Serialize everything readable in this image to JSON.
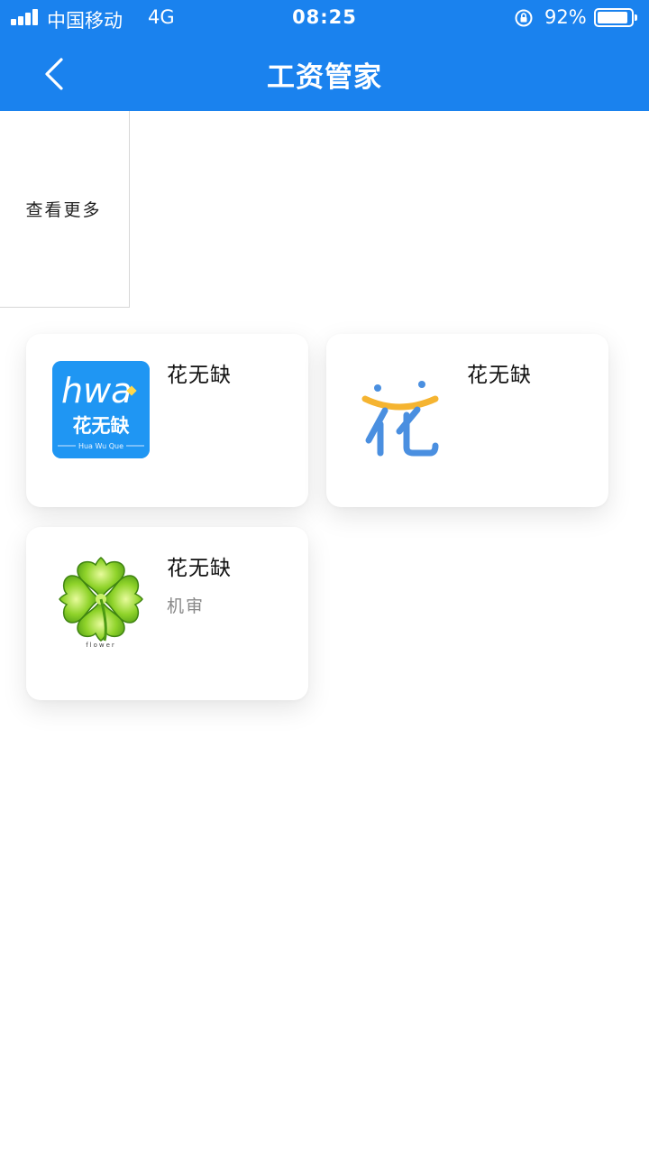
{
  "status_bar": {
    "carrier": "中国移动",
    "network": "4G",
    "time": "08:25",
    "battery": "92%",
    "battery_level": 0.92
  },
  "nav": {
    "title": "工资管家",
    "back_icon": "chevron-left-icon"
  },
  "more": {
    "label": "查看更多"
  },
  "cards": [
    {
      "name": "花无缺",
      "subtitle": "",
      "logo_icon": "hwq-logo-icon",
      "logo_text": "花无缺",
      "logo_word": "hwa",
      "logo_caption": "Hua Wu Que"
    },
    {
      "name": "花无缺",
      "subtitle": "",
      "logo_icon": "hua-character-logo-icon",
      "logo_text": "花"
    },
    {
      "name": "花无缺",
      "subtitle": "机审",
      "logo_icon": "four-leaf-clover-icon",
      "logo_caption": "flower"
    }
  ],
  "colors": {
    "brand_blue": "#1a82ee",
    "clover_green": "#7cc520"
  }
}
